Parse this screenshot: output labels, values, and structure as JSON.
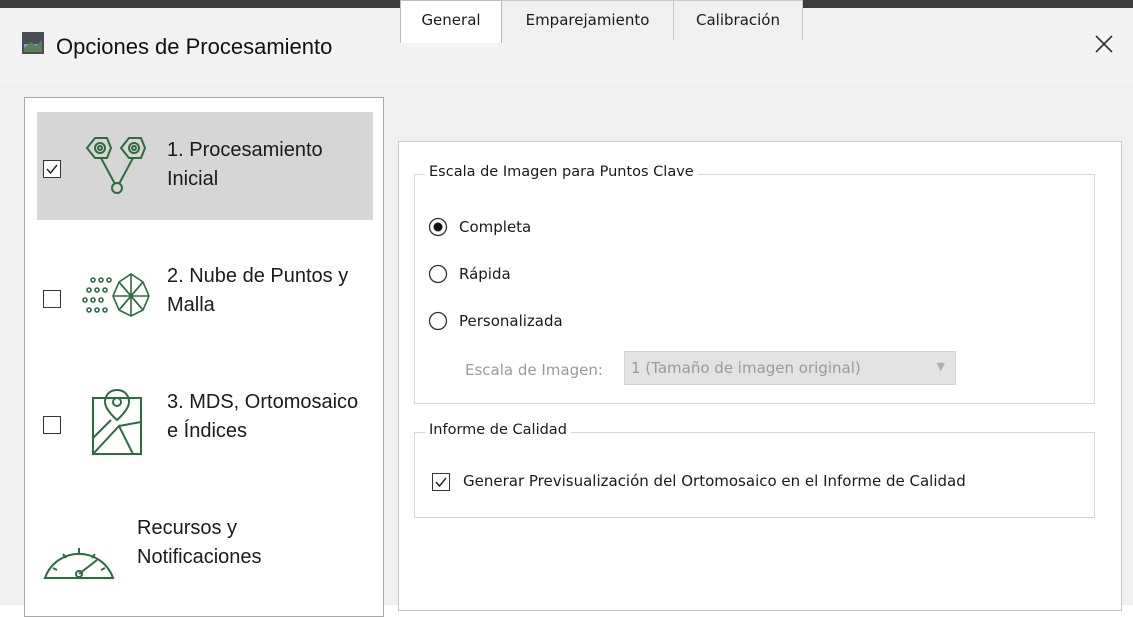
{
  "window": {
    "title": "Opciones de Procesamiento",
    "close_icon": "close-icon"
  },
  "nav": {
    "items": [
      {
        "label": "1. Procesamiento\nInicial",
        "checked": true,
        "selected": true,
        "icon": "processing-icon"
      },
      {
        "label": "2. Nube de Puntos y\nMalla",
        "checked": false,
        "selected": false,
        "icon": "point-cloud-icon"
      },
      {
        "label": "3. MDS, Ortomosaico\ne Índices",
        "checked": false,
        "selected": false,
        "icon": "map-icon"
      },
      {
        "label": "Recursos y\nNotificaciones",
        "icon": "gauge-icon"
      }
    ]
  },
  "tabs": [
    {
      "label": "General",
      "active": true
    },
    {
      "label": "Emparejamiento",
      "active": false
    },
    {
      "label": "Calibración",
      "active": false
    }
  ],
  "keypoints_group": {
    "title": "Escala de Imagen para Puntos Clave",
    "options": [
      {
        "label": "Completa",
        "selected": true
      },
      {
        "label": "Rápida",
        "selected": false
      },
      {
        "label": "Personalizada",
        "selected": false
      }
    ],
    "scale_label": "Escala de Imagen:",
    "scale_value": "1 (Tamaño de imagen original)"
  },
  "quality_group": {
    "title": "Informe de Calidad",
    "checkbox_label": "Generar Previsualización del Ortomosaico en el Informe de Calidad",
    "checked": true
  },
  "colors": {
    "selected_bg": "#d6d6d6",
    "icon_green": "#2e6b3f"
  }
}
